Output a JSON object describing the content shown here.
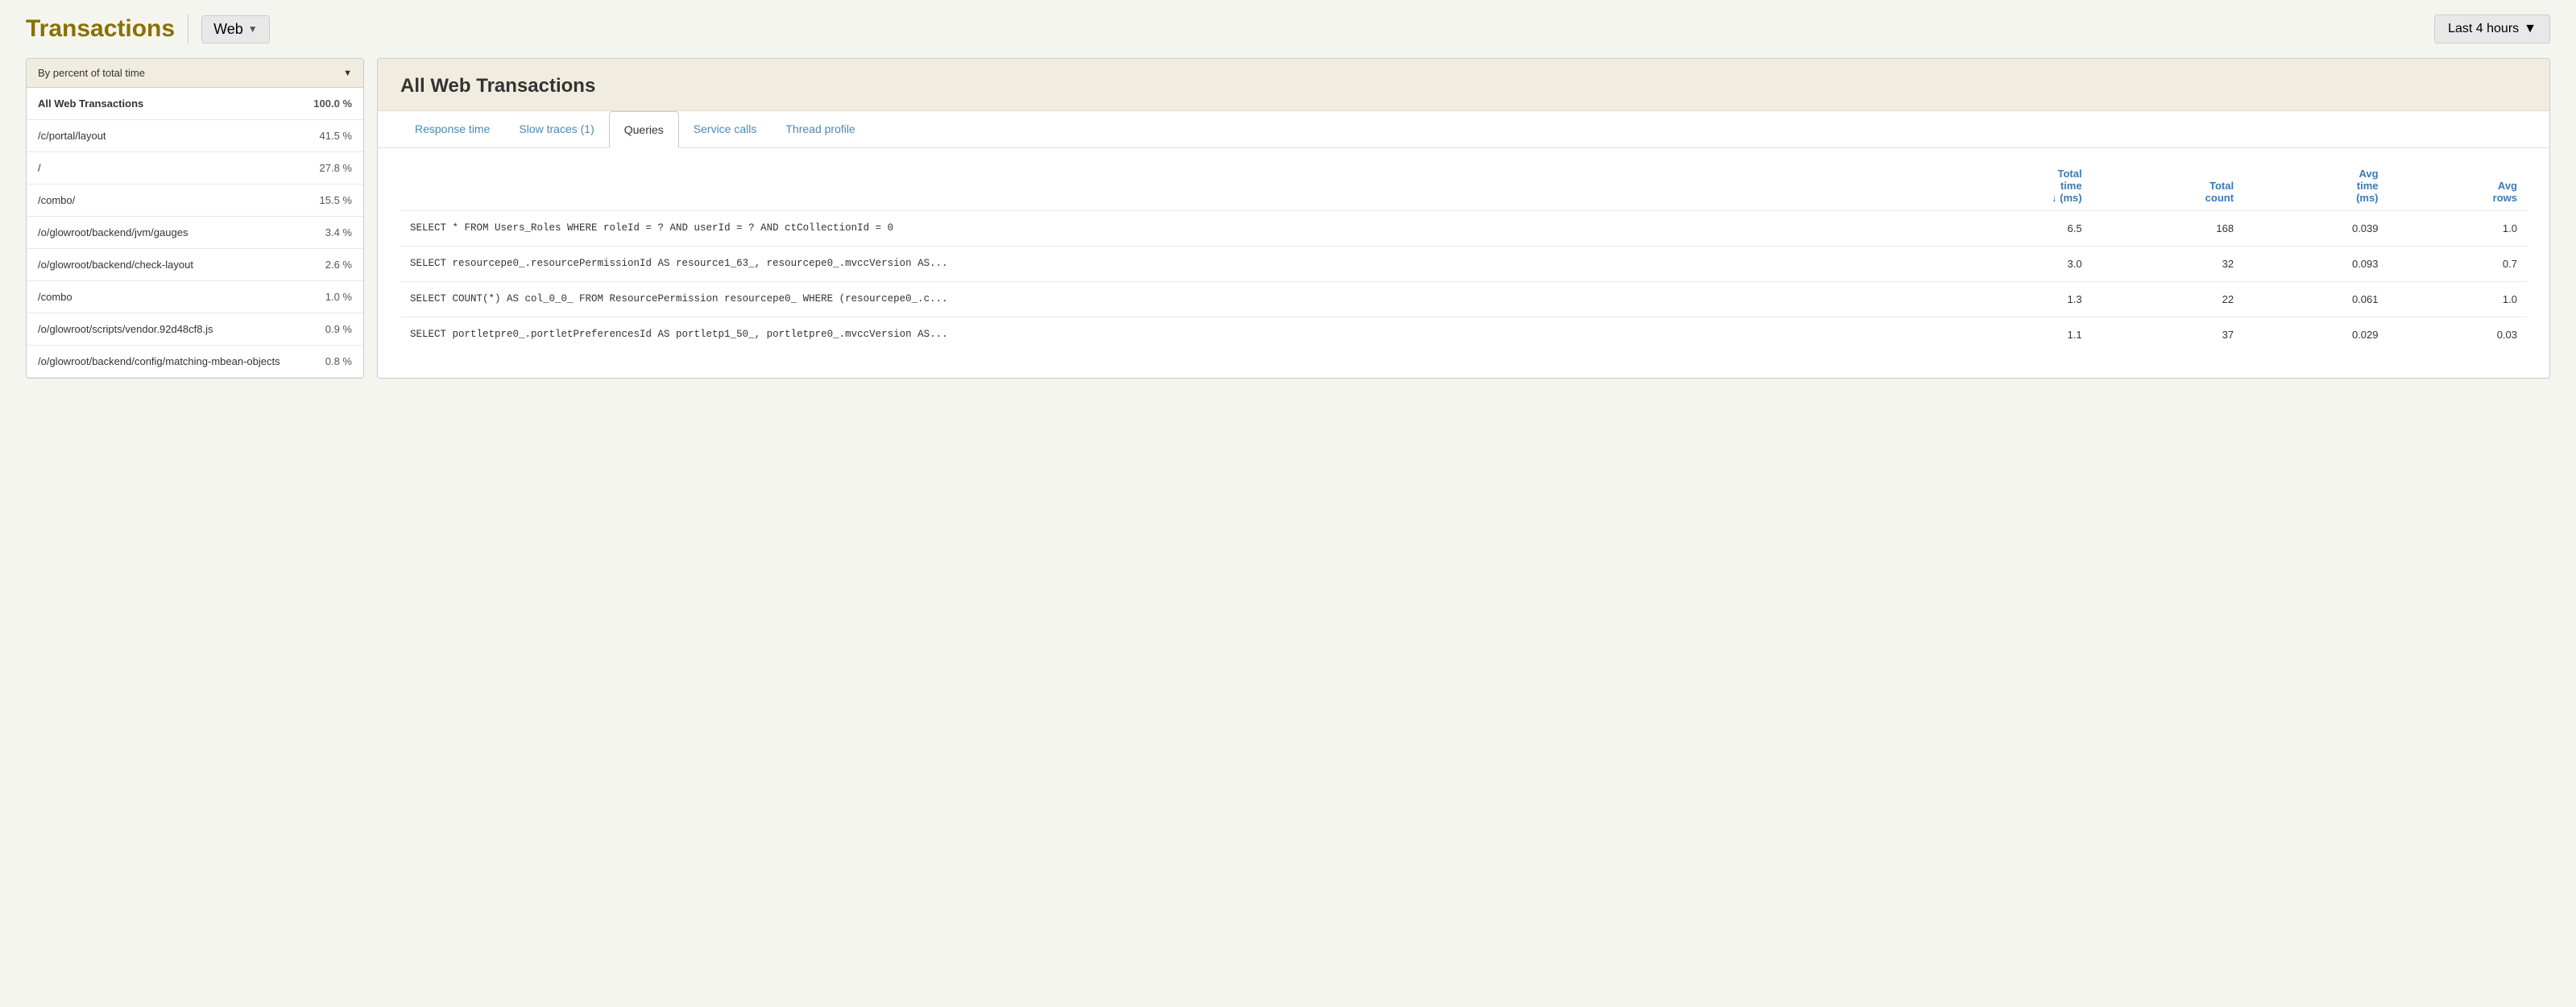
{
  "header": {
    "title": "Transactions",
    "web_label": "Web",
    "time_label": "Last 4 hours"
  },
  "sort_dropdown": {
    "label": "By percent of total time"
  },
  "transactions": [
    {
      "name": "All Web Transactions",
      "percent": "100.0 %",
      "active": true
    },
    {
      "name": "/c/portal/layout",
      "percent": "41.5 %",
      "active": false
    },
    {
      "name": "/",
      "percent": "27.8 %",
      "active": false
    },
    {
      "name": "/combo/",
      "percent": "15.5 %",
      "active": false
    },
    {
      "name": "/o/glowroot/backend/jvm/gauges",
      "percent": "3.4 %",
      "active": false
    },
    {
      "name": "/o/glowroot/backend/check-layout",
      "percent": "2.6 %",
      "active": false
    },
    {
      "name": "/combo",
      "percent": "1.0 %",
      "active": false
    },
    {
      "name": "/o/glowroot/scripts/vendor.92d48cf8.js",
      "percent": "0.9 %",
      "active": false
    },
    {
      "name": "/o/glowroot/backend/config/matching-mbean-objects",
      "percent": "0.8 %",
      "active": false
    }
  ],
  "right_panel": {
    "title": "All Web Transactions",
    "tabs": [
      {
        "label": "Response time",
        "active": false
      },
      {
        "label": "Slow traces (1)",
        "active": false
      },
      {
        "label": "Queries",
        "active": true
      },
      {
        "label": "Service calls",
        "active": false
      },
      {
        "label": "Thread profile",
        "active": false
      }
    ],
    "table": {
      "columns": [
        {
          "label": "Total time ↓ (ms)"
        },
        {
          "label": "Total count"
        },
        {
          "label": "Avg time (ms)"
        },
        {
          "label": "Avg rows"
        }
      ],
      "rows": [
        {
          "query": "SELECT * FROM Users_Roles WHERE roleId = ? AND userId = ? AND ctCollectionId = 0",
          "total_time": "6.5",
          "total_count": "168",
          "avg_time": "0.039",
          "avg_rows": "1.0"
        },
        {
          "query": "SELECT resourcepe0_.resourcePermissionId AS resource1_63_, resourcepe0_.mvccVersion AS...",
          "total_time": "3.0",
          "total_count": "32",
          "avg_time": "0.093",
          "avg_rows": "0.7"
        },
        {
          "query": "SELECT COUNT(*) AS col_0_0_ FROM ResourcePermission resourcepe0_ WHERE (resourcepe0_.c...",
          "total_time": "1.3",
          "total_count": "22",
          "avg_time": "0.061",
          "avg_rows": "1.0"
        },
        {
          "query": "SELECT portletpre0_.portletPreferencesId AS portletp1_50_, portletpre0_.mvccVersion AS...",
          "total_time": "1.1",
          "total_count": "37",
          "avg_time": "0.029",
          "avg_rows": "0.03"
        }
      ]
    }
  }
}
